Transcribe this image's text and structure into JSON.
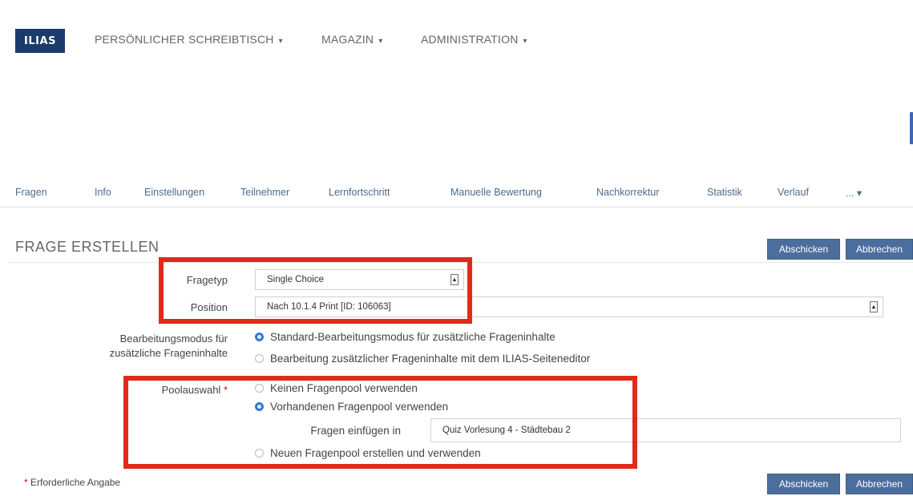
{
  "header": {
    "logo": "ILIAS",
    "nav": [
      {
        "label": "PERSÖNLICHER SCHREIBTISCH",
        "caret": "▾"
      },
      {
        "label": "MAGAZIN",
        "caret": "▾"
      },
      {
        "label": "ADMINISTRATION",
        "caret": "▾"
      }
    ]
  },
  "tabs": [
    "Fragen",
    "Info",
    "Einstellungen",
    "Teilnehmer",
    "Lernfortschritt",
    "Manuelle Bewertung",
    "Nachkorrektur",
    "Statistik",
    "Verlauf",
    "... ▾"
  ],
  "page": {
    "title": "FRAGE ERSTELLEN",
    "submit_label": "Abschicken",
    "cancel_label": "Abbrechen"
  },
  "form": {
    "fragetyp": {
      "label": "Fragetyp",
      "value": "Single Choice"
    },
    "position": {
      "label": "Position",
      "value": "Nach 10.1.4 Print [ID: 106063]"
    },
    "edit_mode": {
      "label_line1": "Bearbeitungsmodus für",
      "label_line2": "zusätzliche Frageninhalte",
      "options": [
        {
          "label": "Standard-Bearbeitungsmodus für zusätzliche Frageninhalte",
          "selected": true
        },
        {
          "label": "Bearbeitung zusätzlicher Frageninhalte mit dem ILIAS-Seiteneditor",
          "selected": false
        }
      ]
    },
    "pool": {
      "label": "Poolauswahl",
      "required_mark": "*",
      "options": [
        {
          "label": "Keinen Fragenpool verwenden",
          "selected": false
        },
        {
          "label": "Vorhandenen Fragenpool verwenden",
          "selected": true
        },
        {
          "label": "Neuen Fragenpool erstellen und verwenden",
          "selected": false
        }
      ],
      "insert_label": "Fragen einfügen in",
      "insert_value": "Quiz Vorlesung 4 - Städtebau 2"
    },
    "required_note_mark": "*",
    "required_note": "Erforderliche Angabe"
  },
  "colors": {
    "highlight": "#e02b1a",
    "button": "#4c6e9c",
    "logo": "#1a3b6b",
    "radio_selected": "#2f7bd6"
  }
}
